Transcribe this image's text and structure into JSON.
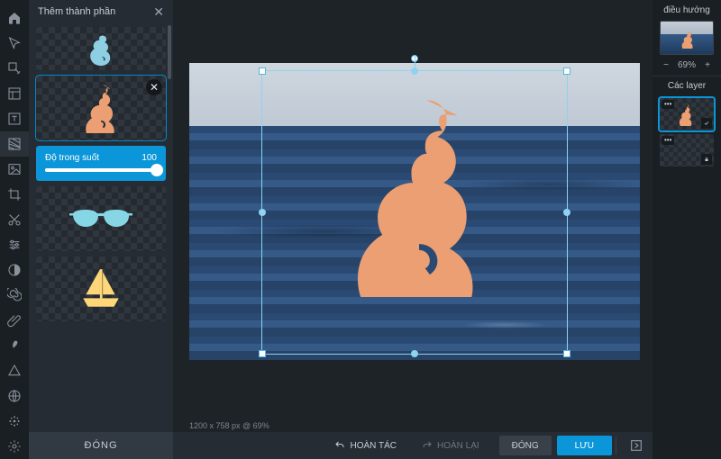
{
  "panel": {
    "title": "Thêm thành phần",
    "opacity_label": "Độ trong suốt",
    "opacity_value": "100",
    "footer_btn": "ĐÓNG"
  },
  "canvas": {
    "info": "1200 x 758 px @ 69%"
  },
  "bottombar": {
    "undo": "HOÀN TÁC",
    "redo": "HOÀN LẠI",
    "close": "ĐÓNG",
    "save": "LƯU"
  },
  "right": {
    "nav_title": "điều hướng",
    "zoom_value": "69%",
    "layers_title": "Các layer"
  },
  "icons": {
    "shell_color_orange": "#ec9f72",
    "shell_color_blue": "#8ecfe4",
    "glasses_color": "#87d6e6",
    "boat_color": "#ffd778"
  }
}
